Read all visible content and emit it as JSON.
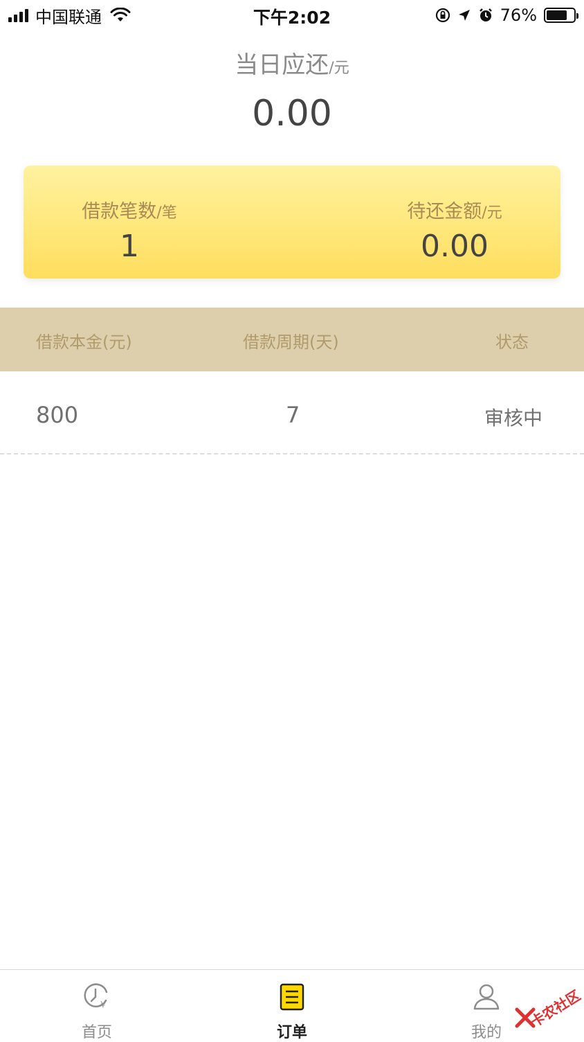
{
  "status_bar": {
    "carrier": "中国联通",
    "time": "下午2:02",
    "battery": "76%",
    "battery_level": 0.76
  },
  "summary": {
    "title": "当日应还",
    "title_unit": "/元",
    "amount": "0.00"
  },
  "card": {
    "count_label": "借款笔数",
    "count_unit": "/笔",
    "count_value": "1",
    "pending_label": "待还金额",
    "pending_unit": "/元",
    "pending_value": "0.00",
    "gradient_top": "#fff29f",
    "gradient_bottom": "#ffde5e"
  },
  "table": {
    "headers": [
      "借款本金(元)",
      "借款周期(天)",
      "状态"
    ],
    "rows": [
      [
        "800",
        "7",
        "审核中"
      ]
    ],
    "header_bg": "#decfac"
  },
  "tabbar": {
    "items": [
      {
        "label": "首页",
        "icon": "clock-yen-icon"
      },
      {
        "label": "订单",
        "icon": "order-list-icon",
        "active": true
      },
      {
        "label": "我的",
        "icon": "user-icon"
      }
    ]
  },
  "watermark": {
    "text": "卡农社区"
  }
}
